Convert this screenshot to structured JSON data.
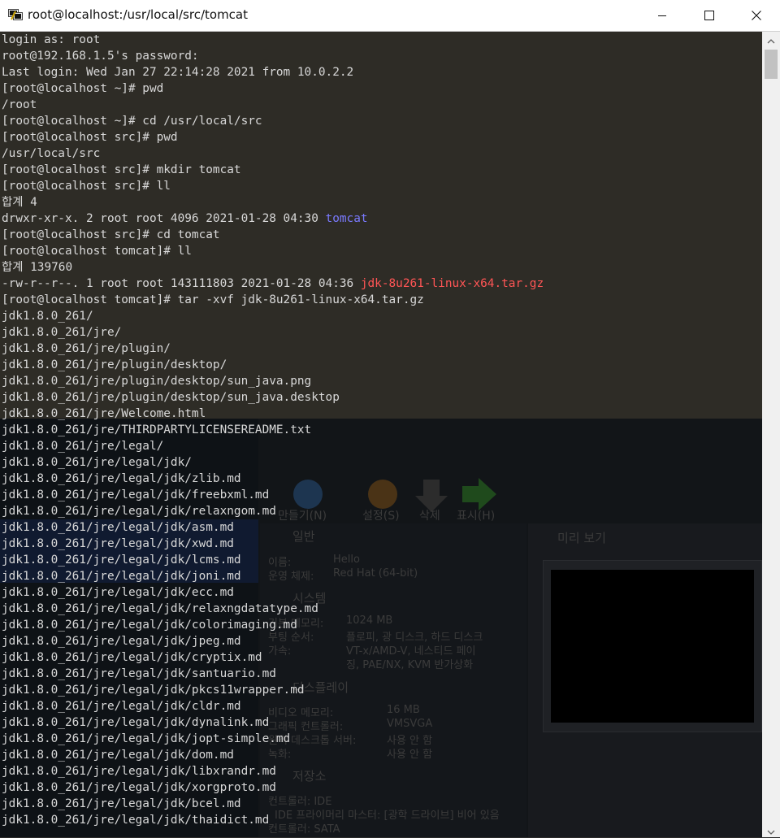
{
  "window": {
    "title": "root@localhost:/usr/local/src/tomcat"
  },
  "icons": {
    "app": "putty-terminal-icon",
    "minimize": "minimize-icon",
    "maximize": "maximize-icon",
    "close": "close-icon",
    "scroll_up": "scroll-up-icon",
    "scroll_down": "scroll-down-icon"
  },
  "terminal": {
    "lines": [
      [
        {
          "t": "login as: root"
        }
      ],
      [
        {
          "t": "root@192.168.1.5's password:"
        }
      ],
      [
        {
          "t": "Last login: Wed Jan 27 22:14:28 2021 from 10.0.2.2"
        }
      ],
      [
        {
          "t": "[root@localhost ~]# pwd"
        }
      ],
      [
        {
          "t": "/root"
        }
      ],
      [
        {
          "t": "[root@localhost ~]# cd /usr/local/src"
        }
      ],
      [
        {
          "t": "[root@localhost src]# pwd"
        }
      ],
      [
        {
          "t": "/usr/local/src"
        }
      ],
      [
        {
          "t": "[root@localhost src]# mkdir tomcat"
        }
      ],
      [
        {
          "t": "[root@localhost src]# ll"
        }
      ],
      [
        {
          "t": "합계 4"
        }
      ],
      [
        {
          "t": "drwxr-xr-x. 2 root root 4096 2021-01-28 04:30 "
        },
        {
          "t": "tomcat",
          "c": "blue"
        }
      ],
      [
        {
          "t": "[root@localhost src]# cd tomcat"
        }
      ],
      [
        {
          "t": "[root@localhost tomcat]# ll"
        }
      ],
      [
        {
          "t": "합계 139760"
        }
      ],
      [
        {
          "t": "-rw-r--r--. 1 root root 143111803 2021-01-28 04:36 "
        },
        {
          "t": "jdk-8u261-linux-x64.tar.gz",
          "c": "red"
        }
      ],
      [
        {
          "t": "[root@localhost tomcat]# tar -xvf jdk-8u261-linux-x64.tar.gz"
        }
      ],
      [
        {
          "t": "jdk1.8.0_261/"
        }
      ],
      [
        {
          "t": "jdk1.8.0_261/jre/"
        }
      ],
      [
        {
          "t": "jdk1.8.0_261/jre/plugin/"
        }
      ],
      [
        {
          "t": "jdk1.8.0_261/jre/plugin/desktop/"
        }
      ],
      [
        {
          "t": "jdk1.8.0_261/jre/plugin/desktop/sun_java.png"
        }
      ],
      [
        {
          "t": "jdk1.8.0_261/jre/plugin/desktop/sun_java.desktop"
        }
      ],
      [
        {
          "t": "jdk1.8.0_261/jre/Welcome.html"
        }
      ],
      [
        {
          "t": "jdk1.8.0_261/jre/THIRDPARTYLICENSEREADME.txt"
        }
      ],
      [
        {
          "t": "jdk1.8.0_261/jre/legal/"
        }
      ],
      [
        {
          "t": "jdk1.8.0_261/jre/legal/jdk/"
        }
      ],
      [
        {
          "t": "jdk1.8.0_261/jre/legal/jdk/zlib.md"
        }
      ],
      [
        {
          "t": "jdk1.8.0_261/jre/legal/jdk/freebxml.md"
        }
      ],
      [
        {
          "t": "jdk1.8.0_261/jre/legal/jdk/relaxngom.md"
        }
      ],
      [
        {
          "t": "jdk1.8.0_261/jre/legal/jdk/asm.md"
        }
      ],
      [
        {
          "t": "jdk1.8.0_261/jre/legal/jdk/xwd.md"
        }
      ],
      [
        {
          "t": "jdk1.8.0_261/jre/legal/jdk/lcms.md"
        }
      ],
      [
        {
          "t": "jdk1.8.0_261/jre/legal/jdk/joni.md"
        }
      ],
      [
        {
          "t": "jdk1.8.0_261/jre/legal/jdk/ecc.md"
        }
      ],
      [
        {
          "t": "jdk1.8.0_261/jre/legal/jdk/relaxngdatatype.md"
        }
      ],
      [
        {
          "t": "jdk1.8.0_261/jre/legal/jdk/colorimaging.md"
        }
      ],
      [
        {
          "t": "jdk1.8.0_261/jre/legal/jdk/jpeg.md"
        }
      ],
      [
        {
          "t": "jdk1.8.0_261/jre/legal/jdk/cryptix.md"
        }
      ],
      [
        {
          "t": "jdk1.8.0_261/jre/legal/jdk/santuario.md"
        }
      ],
      [
        {
          "t": "jdk1.8.0_261/jre/legal/jdk/pkcs11wrapper.md"
        }
      ],
      [
        {
          "t": "jdk1.8.0_261/jre/legal/jdk/cldr.md"
        }
      ],
      [
        {
          "t": "jdk1.8.0_261/jre/legal/jdk/dynalink.md"
        }
      ],
      [
        {
          "t": "jdk1.8.0_261/jre/legal/jdk/jopt-simple.md"
        }
      ],
      [
        {
          "t": "jdk1.8.0_261/jre/legal/jdk/dom.md"
        }
      ],
      [
        {
          "t": "jdk1.8.0_261/jre/legal/jdk/libxrandr.md"
        }
      ],
      [
        {
          "t": "jdk1.8.0_261/jre/legal/jdk/xorgproto.md"
        }
      ],
      [
        {
          "t": "jdk1.8.0_261/jre/legal/jdk/bcel.md"
        }
      ],
      [
        {
          "t": "jdk1.8.0_261/jre/legal/jdk/thaidict.md"
        }
      ]
    ]
  },
  "colors": {
    "text": "#d8d8d8",
    "directory": "#7a7aff",
    "archive": "#ff5555",
    "terminal_bg_upper": "#2e2c26",
    "terminal_bg_lower": "#121518"
  },
  "background_ghost": {
    "toolbar_new": "만들기(N)",
    "toolbar_settings": "설정(S)",
    "toolbar_delete": "삭제",
    "toolbar_show": "표시(H)",
    "section_general": "일반",
    "name_label": "이름:",
    "name_value": "Hello",
    "os_label": "운영 체제:",
    "os_value": "Red Hat (64-bit)",
    "section_system": "시스템",
    "memory_label": "기본 메모리:",
    "memory_value": "1024 MB",
    "boot_label": "부팅 순서:",
    "boot_value": "플로피, 광 디스크, 하드 디스크",
    "accel_label": "가속:",
    "accel_value_1": "VT-x/AMD-V, 네스티드 페이",
    "accel_value_2": "징, PAE/NX, KVM 반가상화",
    "section_display": "디스플레이",
    "vram_label": "비디오 메모리:",
    "vram_value": "16 MB",
    "gfx_label": "그래픽 컨트롤러:",
    "gfx_value": "VMSVGA",
    "rdp_label": "원격 데스크톱 서버:",
    "rdp_value": "사용 안 함",
    "rec_label": "녹화:",
    "rec_value": "사용 안 함",
    "section_storage": "저장소",
    "ctrl_ide": "컨트롤러: IDE",
    "ide_primary": "IDE 프라이머리 마스터:  [광학 드라이브] 비어 있음",
    "ctrl_sata": "컨트롤러: SATA",
    "section_preview": "미리 보기"
  }
}
